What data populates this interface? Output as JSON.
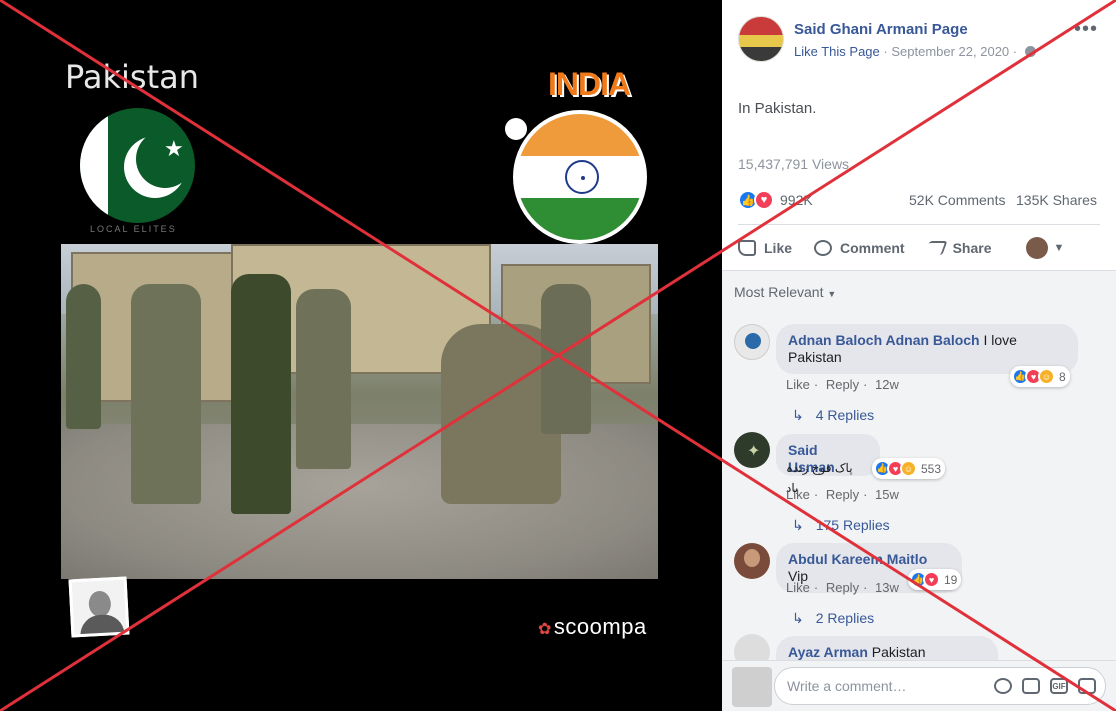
{
  "media": {
    "title": "Pakistan",
    "pk_caption": "LOCAL  ELITES",
    "india_logo": "INDIA",
    "watermark": "scoompa"
  },
  "post": {
    "page_name": "Said Ghani Armani Page",
    "like_link": "Like This Page",
    "date": "September 22, 2020",
    "text": "In Pakistan.",
    "views": "15,437,791 Views",
    "reaction_count": "992K",
    "comments": "52K Comments",
    "shares": "135K Shares"
  },
  "actions": {
    "like": "Like",
    "comment": "Comment",
    "share": "Share"
  },
  "sort_label": "Most Relevant",
  "comments": [
    {
      "name": "Adnan Baloch Adnan Baloch",
      "text": "I love Pakistan",
      "like": "Like",
      "reply": "Reply",
      "time": "12w",
      "reaction_count": "8",
      "replies": "4 Replies"
    },
    {
      "name": "Said Usman",
      "text": "پاک فوج زندہ باد",
      "like": "Like",
      "reply": "Reply",
      "time": "15w",
      "reaction_count": "553",
      "replies": "175 Replies"
    },
    {
      "name": "Abdul Kareem Maitlo",
      "text": "Vip",
      "like": "Like",
      "reply": "Reply",
      "time": "13w",
      "reaction_count": "19",
      "replies": "2 Replies"
    },
    {
      "name": "Ayaz Arman",
      "text": "Pakistan zindabad"
    }
  ],
  "write_placeholder": "Write a comment…",
  "colors": {
    "fb_link": "#385898",
    "x_red": "#e0313a",
    "like_blue": "#1877f2",
    "love_red": "#f33e58"
  },
  "icons": [
    "globe-icon",
    "more-icon",
    "like-icon",
    "comment-icon",
    "share-icon",
    "emoji-icon",
    "camera-icon",
    "gif-icon",
    "sticker-icon"
  ]
}
